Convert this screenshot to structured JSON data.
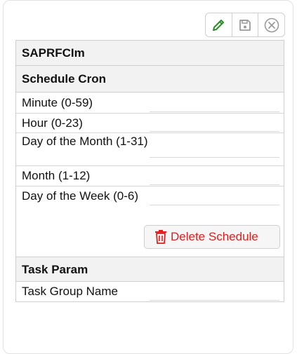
{
  "toolbar": {
    "edit_icon": "pencil-icon",
    "save_icon": "floppy-disk-icon",
    "close_icon": "close-circle-icon"
  },
  "form": {
    "title": "SAPRFCIm",
    "schedule_section": "Schedule Cron",
    "fields": [
      {
        "label": "Minute (0-59)",
        "value": ""
      },
      {
        "label": "Hour (0-23)",
        "value": ""
      },
      {
        "label": "Day of the Month (1-31)",
        "value": ""
      },
      {
        "label": "Month (1-12)",
        "value": ""
      },
      {
        "label": "Day of the Week (0-6)",
        "value": ""
      }
    ],
    "delete_label": "Delete Schedule",
    "task_section": "Task Param",
    "task_fields": [
      {
        "label": "Task Group Name",
        "value": ""
      }
    ]
  },
  "colors": {
    "edit_green": "#2e8b2e",
    "delete_red": "#e02020",
    "header_bg": "#f2f2f2",
    "border": "#cfcfcf"
  }
}
